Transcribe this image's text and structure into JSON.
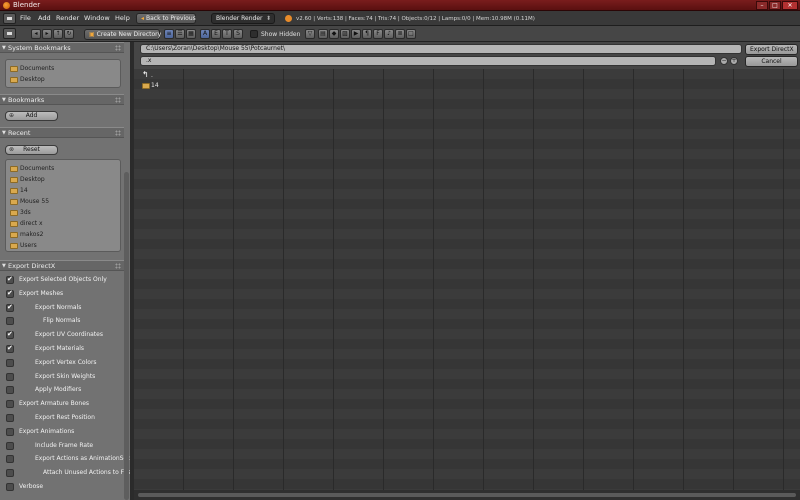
{
  "window": {
    "title": "Blender"
  },
  "menu": [
    "File",
    "Add",
    "Render",
    "Window",
    "Help"
  ],
  "infobar": {
    "back_button": "Back to Previous",
    "render_engine": "Blender Render",
    "stats": "v2.60 | Verts:138 | Faces:74 | Tris:74 | Objects:0/12 | Lamps:0/0 | Mem:10.98M (0.11M)"
  },
  "toolbar": {
    "create_dir": "Create New Directory",
    "show_hidden": "Show Hidden"
  },
  "sidebar": {
    "system_bookmarks": {
      "title": "System Bookmarks",
      "items": [
        "Documents",
        "Desktop"
      ]
    },
    "bookmarks": {
      "title": "Bookmarks",
      "add_label": "Add"
    },
    "recent": {
      "title": "Recent",
      "reset_label": "Reset",
      "items": [
        "Documents",
        "Desktop",
        "14",
        "Mouse 55",
        "3ds",
        "direct x",
        "makos2",
        "Users"
      ]
    },
    "export": {
      "title": "Export DirectX",
      "options": [
        {
          "label": "Export Selected Objects Only",
          "checked": true,
          "indent": 0
        },
        {
          "label": "Export Meshes",
          "checked": true,
          "indent": 0
        },
        {
          "label": "Export Normals",
          "checked": true,
          "indent": 1
        },
        {
          "label": "Flip Normals",
          "checked": false,
          "indent": 2
        },
        {
          "label": "Export UV Coordinates",
          "checked": true,
          "indent": 1
        },
        {
          "label": "Export Materials",
          "checked": true,
          "indent": 1
        },
        {
          "label": "Export Vertex Colors",
          "checked": false,
          "indent": 1
        },
        {
          "label": "Export Skin Weights",
          "checked": false,
          "indent": 1
        },
        {
          "label": "Apply Modifiers",
          "checked": false,
          "indent": 1
        },
        {
          "label": "Export Armature Bones",
          "checked": false,
          "indent": 0
        },
        {
          "label": "Export Rest Position",
          "checked": false,
          "indent": 1
        },
        {
          "label": "Export Animations",
          "checked": false,
          "indent": 0
        },
        {
          "label": "Include Frame Rate",
          "checked": false,
          "indent": 1
        },
        {
          "label": "Export Actions as AnimationSets",
          "checked": false,
          "indent": 1
        },
        {
          "label": "Attach Unused Actions to First",
          "checked": false,
          "indent": 2
        },
        {
          "label": "Verbose",
          "checked": false,
          "indent": 0
        }
      ]
    }
  },
  "pathbar": {
    "directory": "C:\\Users\\Zoran\\Desktop\\Mouse 55\\Potcaurnet\\",
    "filename": ".x",
    "export_button": "Export DirectX",
    "cancel_button": "Cancel"
  },
  "files": {
    "parent": ".",
    "items": [
      "14"
    ]
  }
}
